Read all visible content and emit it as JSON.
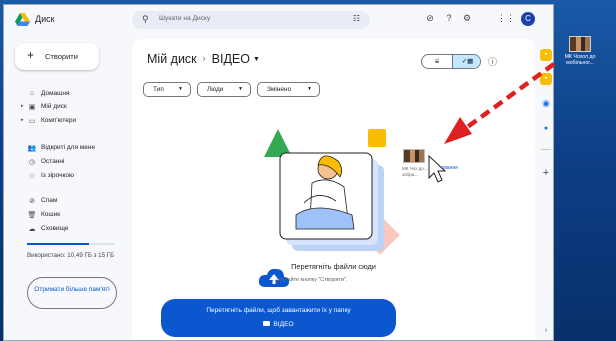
{
  "app": {
    "title": "Диск"
  },
  "search": {
    "placeholder": "Шукати на Диску"
  },
  "sidebar": {
    "create_label": "Створити",
    "items": [
      {
        "label": "Домашня",
        "icon": "home-icon",
        "glyph": "⌂"
      },
      {
        "label": "Мій диск",
        "icon": "drive-icon",
        "glyph": "▣"
      },
      {
        "label": "Комп'ютери",
        "icon": "computer-icon",
        "glyph": "▭"
      },
      {
        "label": "Відкриті для мене",
        "icon": "shared-icon",
        "glyph": "👥"
      },
      {
        "label": "Останні",
        "icon": "clock-icon",
        "glyph": "◷"
      },
      {
        "label": "Із зірочкою",
        "icon": "star-icon",
        "glyph": "☆"
      },
      {
        "label": "Спам",
        "icon": "spam-icon",
        "glyph": "⊘"
      },
      {
        "label": "Кошик",
        "icon": "trash-icon",
        "glyph": "🗑"
      },
      {
        "label": "Сховище",
        "icon": "cloud-icon",
        "glyph": "☁"
      }
    ],
    "storage_text": "Використано: 10,49 ГБ з 15 ГБ",
    "storage_fraction": 0.7,
    "get_more_label": "Отримати більше пам'яті"
  },
  "main": {
    "breadcrumb_root": "Мій диск",
    "breadcrumb_current": "ВІДЕО",
    "filters": [
      "Тип",
      "Люди",
      "Змінено"
    ],
    "drop_title": "Перетягніть файли сюди",
    "drop_subtitle": "...ристайте кнопку \"Створити\".",
    "upload_banner_line1": "Перетягніть файли, щоб завантажити їх у папку",
    "upload_banner_folder": "ВІДЕО"
  },
  "drag": {
    "ghost_caption": "МК Чох до... зобра...",
    "badge": "...ковання"
  },
  "desktop": {
    "file_label": "МК Чохол до мобільног..."
  },
  "colors": {
    "accent": "#0b57d0",
    "chip_selected": "#c2e7ff",
    "arrow": "#e02020"
  }
}
